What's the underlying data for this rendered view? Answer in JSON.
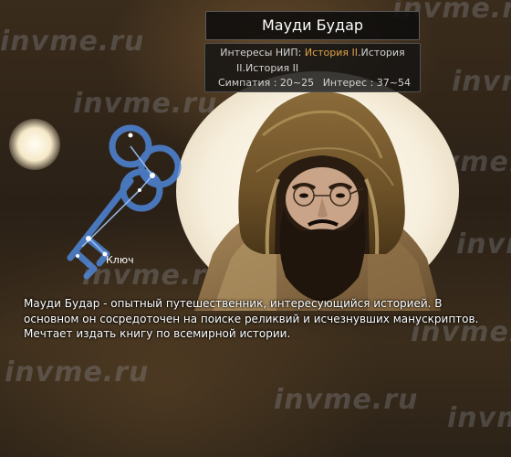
{
  "npc": {
    "name": "Мауди Будар",
    "interests_label": "Интересы НИП:",
    "interests_highlight": "История II",
    "interests_rest": ".История",
    "interests_line2": "II.История II",
    "sympathy": "Симпатия : 20~25",
    "interest": "Интерес : 37~54"
  },
  "key": {
    "label": "Ключ",
    "icon": "constellation-key-icon"
  },
  "description": [
    "Мауди Будар - опытный путешественник, интересующийся историей. В",
    "основном он сосредоточен на поиске реликвий и исчезнувших манускриптов.",
    "Мечтает издать книгу по всемирной истории."
  ],
  "watermark": "invme.ru",
  "colors": {
    "highlight": "#e0a24b",
    "key_glow": "#5b8ed6",
    "text": "#ffffff"
  }
}
